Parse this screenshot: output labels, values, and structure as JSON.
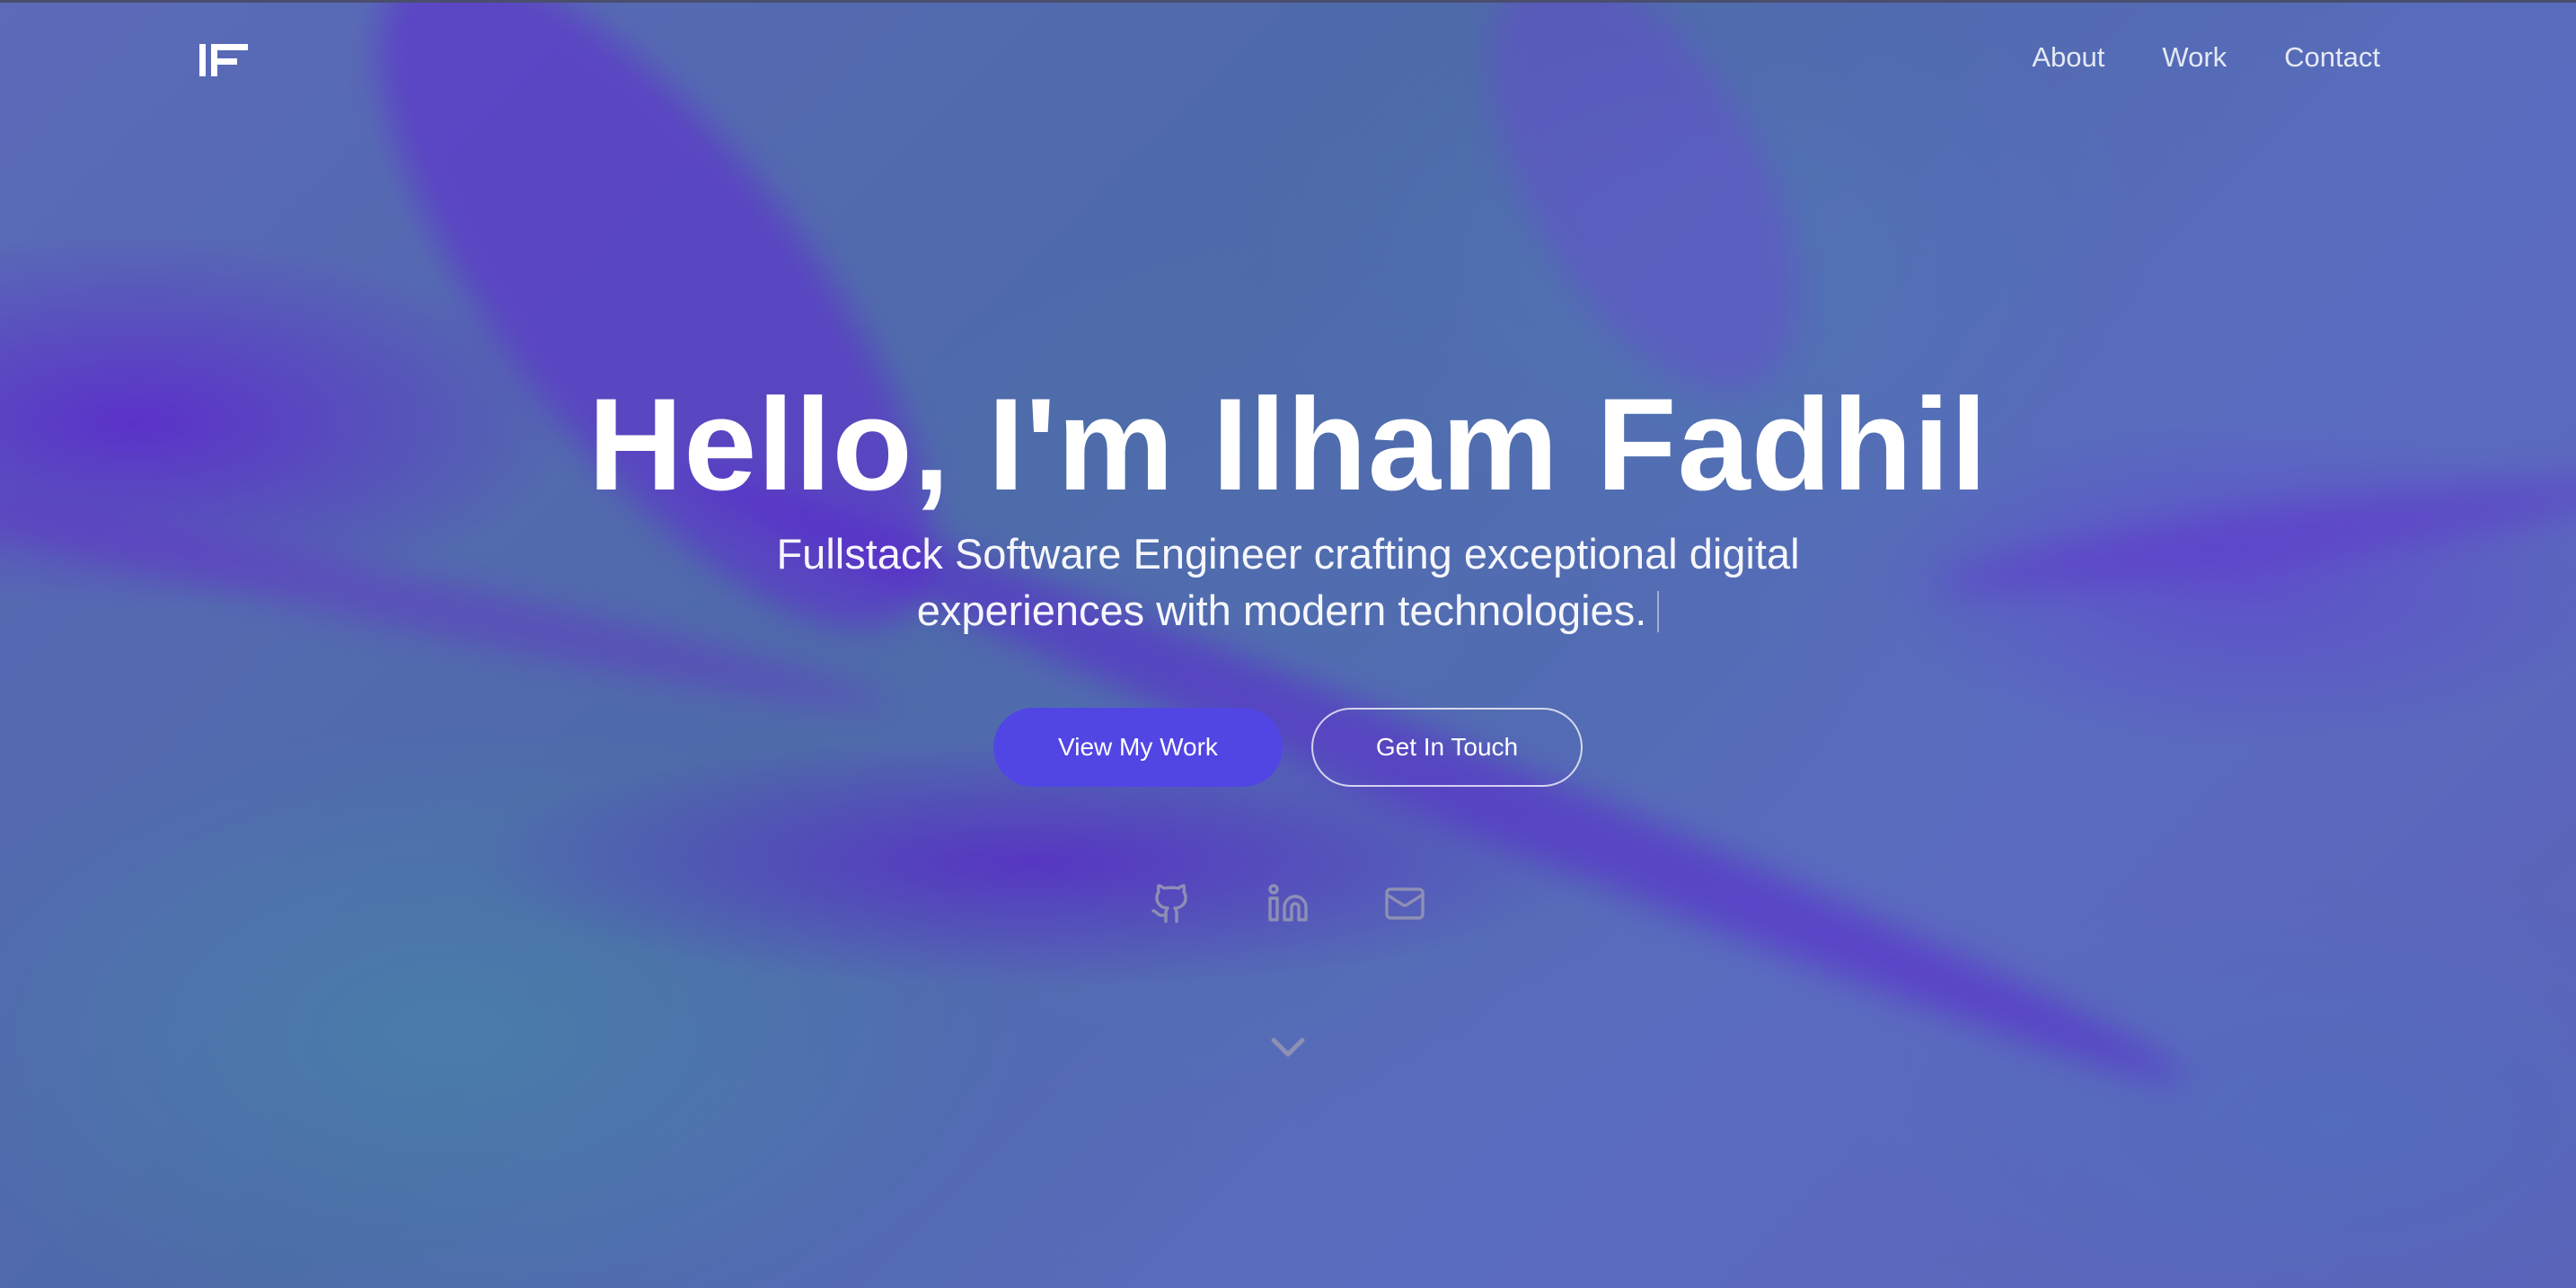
{
  "header": {
    "logo_text": "IF",
    "nav": [
      {
        "label": "About"
      },
      {
        "label": "Work"
      },
      {
        "label": "Contact"
      }
    ]
  },
  "hero": {
    "title": "Hello, I'm Ilham Fadhil",
    "subtitle": "Fullstack Software Engineer crafting exceptional digital experiences with modern technologies."
  },
  "actions": {
    "primary_label": "View My Work",
    "secondary_label": "Get In Touch"
  },
  "social": [
    {
      "icon": "github-icon"
    },
    {
      "icon": "linkedin-icon"
    },
    {
      "icon": "mail-icon"
    }
  ],
  "scroll_indicator": {
    "icon": "chevron-down-icon"
  },
  "colors": {
    "accent": "#5146e4",
    "text": "#ffffff",
    "icon_muted": "#8e8fb4"
  }
}
